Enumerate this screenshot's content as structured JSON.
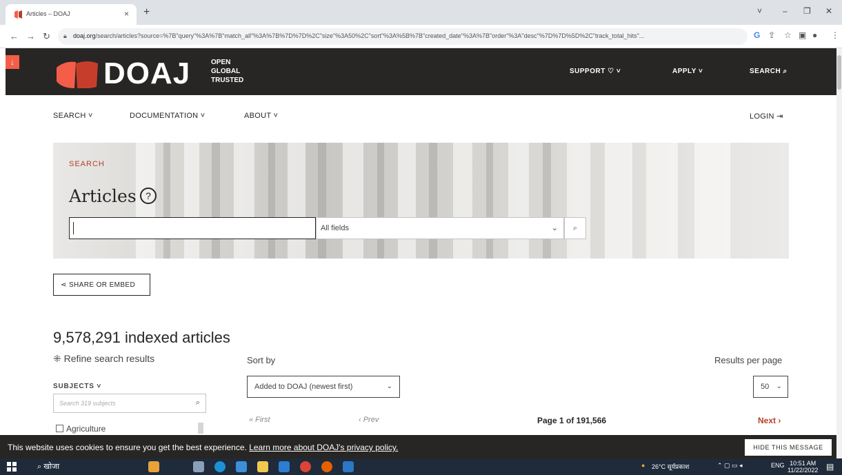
{
  "browser": {
    "tab_title": "Articles – DOAJ",
    "tab_close": "×",
    "new_tab": "+",
    "url_domain": "doaj.org",
    "url_path": "/search/articles?source=%7B\"query\"%3A%7B\"match_all\"%3A%7B%7D%7D%2C\"size\"%3A50%2C\"sort\"%3A%5B%7B\"created_date\"%3A%7B\"order\"%3A\"desc\"%7D%7D%5D%2C\"track_total_hits\"..."
  },
  "header": {
    "logo": "DOAJ",
    "tagline_1": "OPEN",
    "tagline_2": "GLOBAL",
    "tagline_3": "TRUSTED",
    "support": "SUPPORT ♡ ˅",
    "apply": "APPLY ˅",
    "search": "SEARCH ⌕"
  },
  "subnav": {
    "search": "SEARCH ˅",
    "documentation": "DOCUMENTATION ˅",
    "about": "ABOUT ˅",
    "login": "LOGIN ⇥"
  },
  "hero": {
    "label": "SEARCH",
    "title": "Articles",
    "help": "?",
    "query_value": "",
    "field_select": "All fields"
  },
  "share_button": "⋖ SHARE OR EMBED",
  "results": {
    "count": "9,578,291 indexed articles",
    "refine": "⁜ Refine search results",
    "sort_by_label": "Sort by",
    "results_per_page_label": "Results per page",
    "subjects_label": "SUBJECTS ˅",
    "subjects_search_placeholder": "Search 319 subjects",
    "sort_value": "Added to DOAJ (newest first)",
    "per_page_value": "50",
    "first": "« First",
    "prev": "‹ Prev",
    "page_info": "Page 1 of 191,566",
    "next": "Next ›",
    "subject_first": "Agriculture"
  },
  "cookie": {
    "text": "This website uses cookies to ensure you get the best experience. ",
    "link": "Learn more about DOAJ's privacy policy.",
    "hide": "HIDE THIS MESSAGE"
  },
  "taskbar": {
    "search": "खोजा",
    "weather": "26°C सूर्यप्रकाश",
    "lang": "ENG",
    "time": "10:51 AM",
    "date": "11/22/2022"
  },
  "colors": {
    "accent": "#f45d48",
    "dark": "#282624",
    "link_red": "#b2412b"
  }
}
